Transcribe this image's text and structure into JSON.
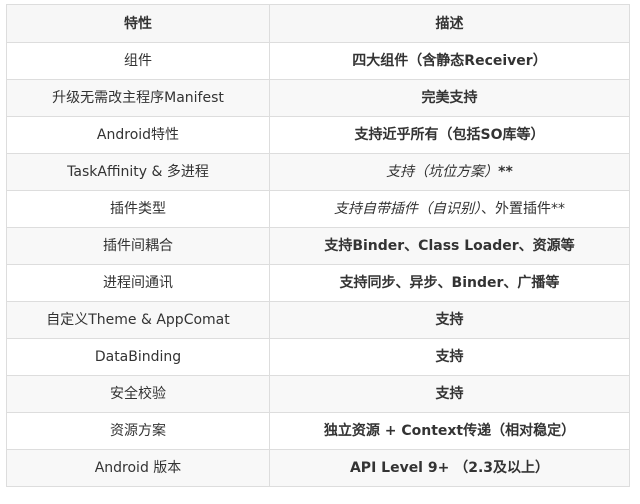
{
  "table": {
    "headers": [
      "特性",
      "描述"
    ],
    "rows": [
      {
        "feature": "组件",
        "description": [
          {
            "text": "四大组件（含静态Receiver）",
            "style": "bold"
          }
        ]
      },
      {
        "feature": "升级无需改主程序Manifest",
        "description": [
          {
            "text": "完美支持",
            "style": "bold"
          }
        ]
      },
      {
        "feature": "Android特性",
        "description": [
          {
            "text": "支持近乎所有（包括SO库等）",
            "style": "bold"
          }
        ]
      },
      {
        "feature": "TaskAffinity & 多进程",
        "description": [
          {
            "text": "支持（坑位方案）",
            "style": "italic"
          },
          {
            "text": "**",
            "style": "bold"
          }
        ]
      },
      {
        "feature": "插件类型",
        "description": [
          {
            "text": "支持自带插件（自识别）",
            "style": "italic"
          },
          {
            "text": "、外置插件**",
            "style": "normal"
          }
        ]
      },
      {
        "feature": "插件间耦合",
        "description": [
          {
            "text": "支持Binder、Class Loader、资源等",
            "style": "bold"
          }
        ]
      },
      {
        "feature": "进程间通讯",
        "description": [
          {
            "text": "支持同步、异步、Binder、广播等",
            "style": "bold"
          }
        ]
      },
      {
        "feature": "自定义Theme & AppComat",
        "description": [
          {
            "text": "支持",
            "style": "bold"
          }
        ]
      },
      {
        "feature": "DataBinding",
        "description": [
          {
            "text": "支持",
            "style": "bold"
          }
        ]
      },
      {
        "feature": "安全校验",
        "description": [
          {
            "text": "支持",
            "style": "bold"
          }
        ]
      },
      {
        "feature": "资源方案",
        "description": [
          {
            "text": "独立资源 + Context传递（相对稳定）",
            "style": "bold"
          }
        ]
      },
      {
        "feature": "Android 版本",
        "description": [
          {
            "text": "API Level 9+ （2.3及以上）",
            "style": "bold"
          }
        ]
      }
    ]
  }
}
